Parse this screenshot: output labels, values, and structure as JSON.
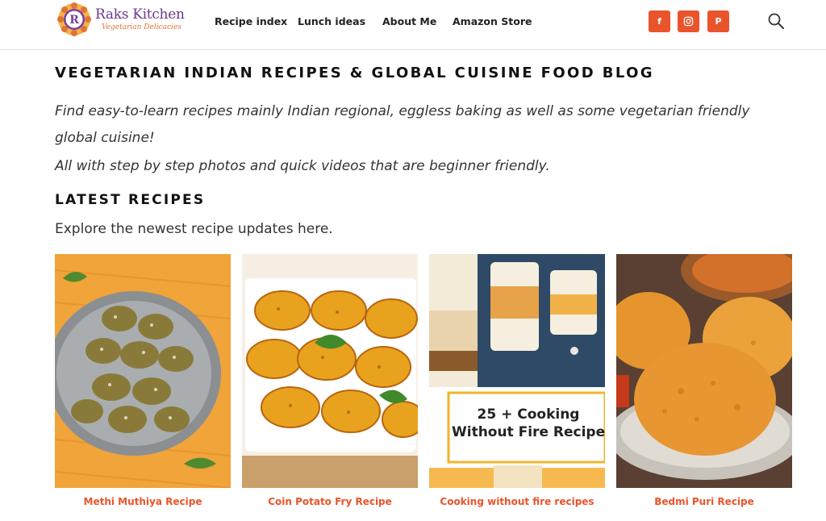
{
  "header": {
    "logo": {
      "title": "Raks Kitchen",
      "subtitle": "Vegetarian Delicacies",
      "initial": "R"
    },
    "nav": [
      {
        "label": "Recipe index"
      },
      {
        "label": "Lunch ideas"
      },
      {
        "label": "About Me"
      },
      {
        "label": "Amazon Store"
      }
    ],
    "social": [
      {
        "icon": "facebook-icon",
        "glyph": "f"
      },
      {
        "icon": "instagram-icon"
      },
      {
        "icon": "pinterest-icon",
        "glyph": "P"
      }
    ],
    "search_icon": "search-icon"
  },
  "main": {
    "title": "VEGETARIAN INDIAN RECIPES & GLOBAL CUISINE FOOD BLOG",
    "intro_1": "Find easy-to-learn recipes mainly Indian regional, eggless baking as well as some vegetarian friendly global cuisine!",
    "intro_2": "All with step by step photos and quick videos that are beginner friendly.",
    "latest_title": "LATEST RECIPES",
    "latest_desc": "Explore the newest recipe updates here.",
    "recipes": [
      {
        "title": "Methi Muthiya Recipe"
      },
      {
        "title": "Coin Potato Fry Recipe"
      },
      {
        "title": "Cooking without fire recipes",
        "overlay_line1": "25 + Cooking",
        "overlay_line2": "Without Fire Recipe"
      },
      {
        "title": "Bedmi Puri Recipe"
      }
    ]
  },
  "colors": {
    "accent": "#e9542b",
    "brand_purple": "#6b3a8e",
    "brand_orange": "#e0733a"
  }
}
